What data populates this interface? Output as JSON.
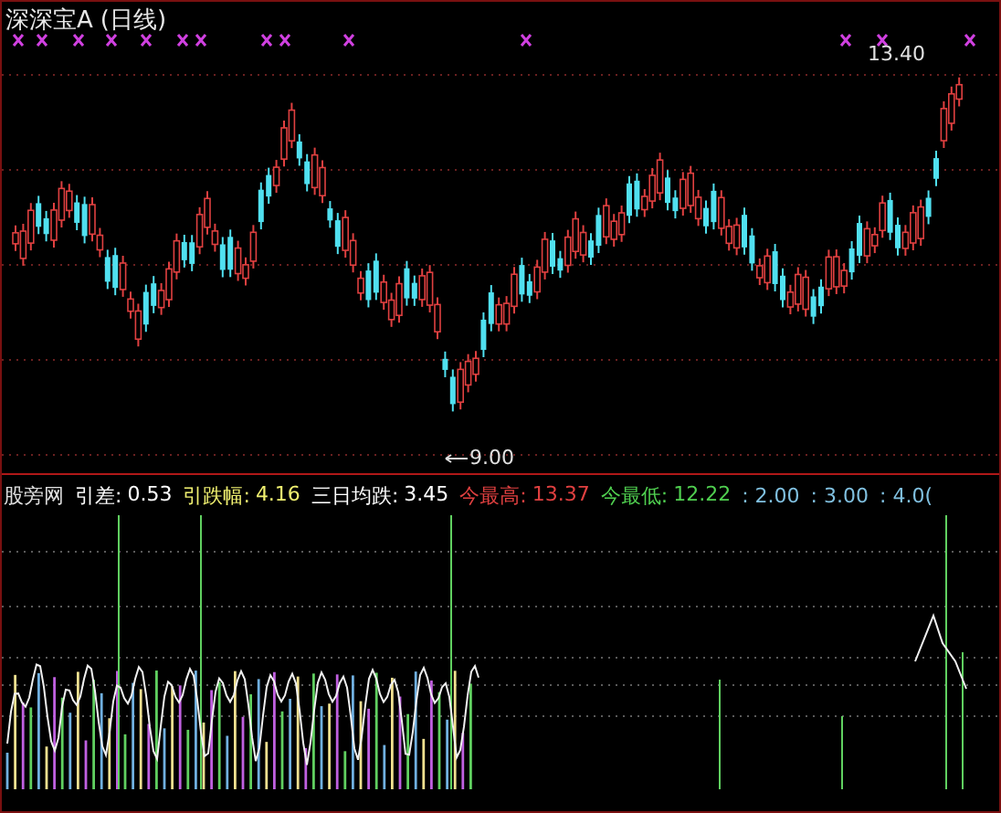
{
  "chart": {
    "title": "深深宝A",
    "period": "(日线)",
    "high_label": "13.40",
    "low_label": "9.00"
  },
  "legend": [
    {
      "name": "股旁网",
      "color": "#e0e0e0"
    },
    {
      "name": "引差:",
      "value": "0.53",
      "color": "#ffffff"
    },
    {
      "name": "引跌幅:",
      "value": "4.16",
      "color": "#f0f070"
    },
    {
      "name": "三日均跌:",
      "value": "3.45",
      "color": "#ffffff"
    },
    {
      "name": "今最高:",
      "value": "13.37",
      "color": "#e04040"
    },
    {
      "name": "今最低:",
      "value": "12.22",
      "color": "#50d050"
    },
    {
      "value": ": 2.00",
      "color": "#80c0e0"
    },
    {
      "value": ": 3.00",
      "color": "#80c0e0"
    },
    {
      "value": ": 4.0(",
      "color": "#80c0e0"
    }
  ]
}
